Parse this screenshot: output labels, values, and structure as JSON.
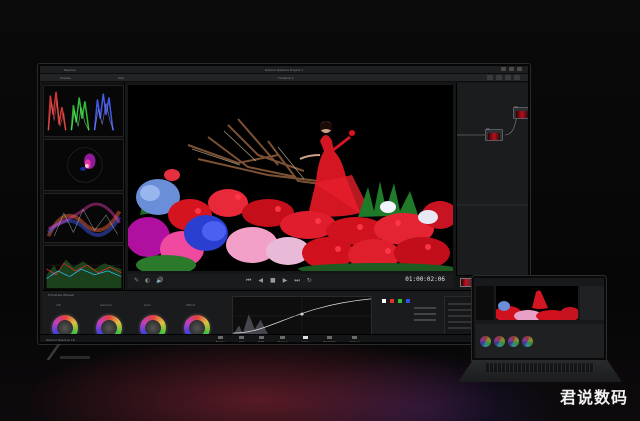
{
  "app": {
    "name": "DaVinci Resolve",
    "menu_left": "Resolve",
    "project_title": "DaVinci Resolve Project 1",
    "toolbar_left": "Scopes",
    "clip_label": "Clip",
    "timeline_label": "Timeline 1"
  },
  "viewer": {
    "timecode": "01:00:02:06",
    "transport": [
      "⏮",
      "◀",
      "■",
      "▶",
      "⏭",
      "↻"
    ],
    "tools": [
      "✎",
      "◐",
      "🔊"
    ]
  },
  "nodes": {
    "labels": [
      "01",
      "02"
    ]
  },
  "color_panel": {
    "title": "Primaries Wheels",
    "wheels": [
      "Lift",
      "Gamma",
      "Gain",
      "Offset"
    ],
    "curves_title": "Curves"
  },
  "pagebar": {
    "product": "DaVinci Resolve 18",
    "pages": [
      "Media",
      "Cut",
      "Edit",
      "Fusion",
      "Color",
      "Fairlight",
      "Deliver"
    ],
    "active_page": "Color"
  },
  "watermark": "君说数码",
  "colors": {
    "accent_red": "#c8101d",
    "ui_dark": "#1a1b1d",
    "timecode": "#e6e6e6"
  }
}
